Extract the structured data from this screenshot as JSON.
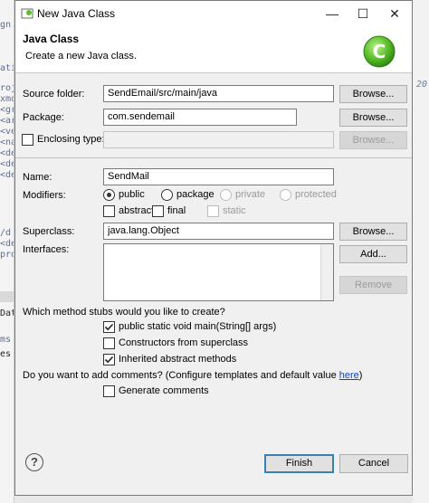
{
  "background": {
    "left_snippets": [
      "gn",
      "ati",
      "roj",
      "xmo",
      "<gr",
      "<ar",
      "<ve",
      "<na",
      "<de",
      "<de",
      "<de",
      "/d",
      "<de",
      "/d",
      "pro",
      "Dat",
      "ms",
      "es t"
    ],
    "right_snippets": [
      "20"
    ]
  },
  "window": {
    "title": "New Java Class",
    "minimize_glyph": "—",
    "maximize_glyph": "☐",
    "close_glyph": "✕"
  },
  "header": {
    "title": "Java Class",
    "description": "Create a new Java class.",
    "wizard_icon": "java-class-wizard-icon",
    "wizard_icon_letter": "C"
  },
  "form": {
    "source_folder": {
      "label": "Source folder:",
      "value": "SendEmail/src/main/java",
      "browse": "Browse..."
    },
    "package": {
      "label": "Package:",
      "value": "com.sendemail",
      "browse": "Browse..."
    },
    "enclosing_type": {
      "label": "Enclosing type:",
      "value": "",
      "checked": false,
      "browse": "Browse..."
    },
    "name": {
      "label": "Name:",
      "value": "SendMail"
    },
    "modifiers": {
      "label": "Modifiers:",
      "access": [
        {
          "label": "public",
          "selected": true,
          "enabled": true
        },
        {
          "label": "package",
          "selected": false,
          "enabled": true
        },
        {
          "label": "private",
          "selected": false,
          "enabled": false
        },
        {
          "label": "protected",
          "selected": false,
          "enabled": false
        }
      ],
      "other": [
        {
          "label": "abstract",
          "checked": false,
          "enabled": true
        },
        {
          "label": "final",
          "checked": false,
          "enabled": true
        },
        {
          "label": "static",
          "checked": false,
          "enabled": false
        }
      ]
    },
    "superclass": {
      "label": "Superclass:",
      "value": "java.lang.Object",
      "browse": "Browse..."
    },
    "interfaces": {
      "label": "Interfaces:",
      "add": "Add...",
      "remove": "Remove"
    }
  },
  "stubs": {
    "question": "Which method stubs would you like to create?",
    "options": [
      {
        "label": "public static void main(String[] args)",
        "checked": true
      },
      {
        "label": "Constructors from superclass",
        "checked": false
      },
      {
        "label": "Inherited abstract methods",
        "checked": true
      }
    ]
  },
  "comments": {
    "question": "Do you want to add comments? (Configure templates and default value ",
    "link": "here",
    "question_end": ")",
    "option": {
      "label": "Generate comments",
      "checked": false
    }
  },
  "footer": {
    "help_glyph": "?",
    "finish": "Finish",
    "cancel": "Cancel"
  },
  "colors": {
    "accent": "#3c7fb1",
    "link": "#0a47c2",
    "wizard_icon_green": "#5cbf2a"
  }
}
